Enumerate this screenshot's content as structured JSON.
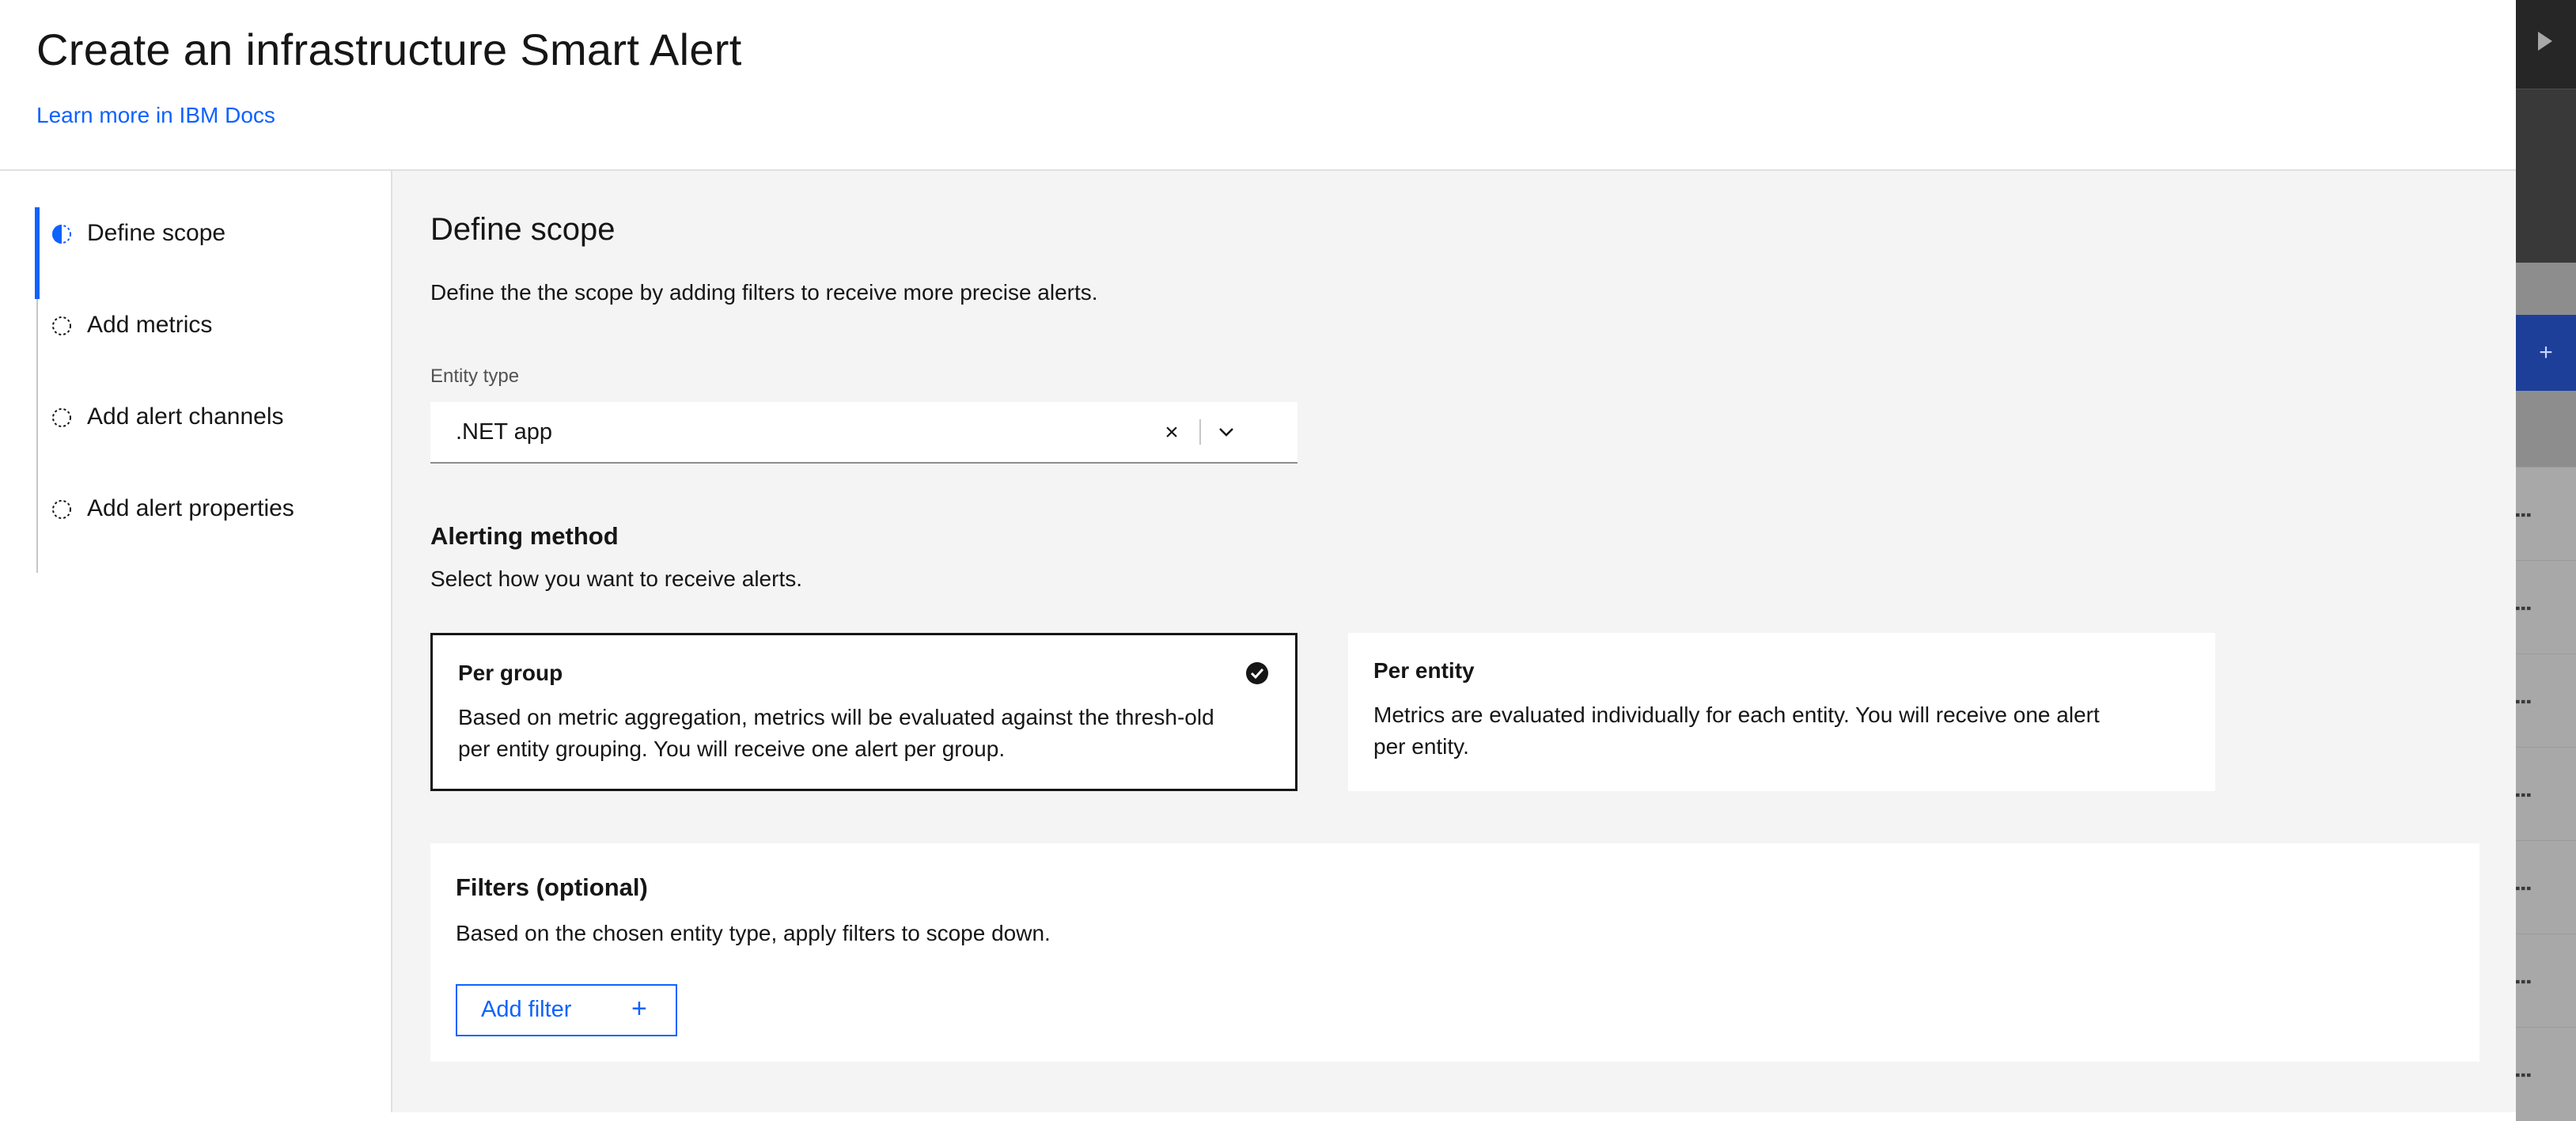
{
  "header": {
    "title": "Create an infrastructure Smart Alert",
    "learn_more": "Learn more in IBM Docs"
  },
  "steps": [
    {
      "label": "Define scope",
      "state": "current"
    },
    {
      "label": "Add metrics",
      "state": "incomplete"
    },
    {
      "label": "Add alert channels",
      "state": "incomplete"
    },
    {
      "label": "Add alert properties",
      "state": "incomplete"
    }
  ],
  "main": {
    "title": "Define scope",
    "description": "Define the the scope by adding filters to receive more precise alerts.",
    "entity_type": {
      "label": "Entity type",
      "value": ".NET app",
      "clear_icon": "close-icon",
      "open_icon": "chevron-down-icon"
    },
    "alerting": {
      "title": "Alerting method",
      "description": "Select how you want to receive alerts.",
      "options": [
        {
          "title": "Per group",
          "body": "Based on metric aggregation, metrics will be evaluated against the thresh-old per entity grouping. You will receive one alert per group.",
          "selected": true
        },
        {
          "title": "Per entity",
          "body": "Metrics are evaluated individually for each entity. You will receive one alert per entity.",
          "selected": false
        }
      ]
    },
    "filters": {
      "title": "Filters (optional)",
      "description": "Based on the chosen entity type, apply filters to scope down.",
      "add_button": "Add filter",
      "add_icon": "+"
    }
  },
  "background": {
    "add_icon": "+"
  },
  "colors": {
    "accent": "#0f62fe",
    "text": "#161616",
    "surface": "#f4f4f4",
    "border_strong": "#161616"
  }
}
